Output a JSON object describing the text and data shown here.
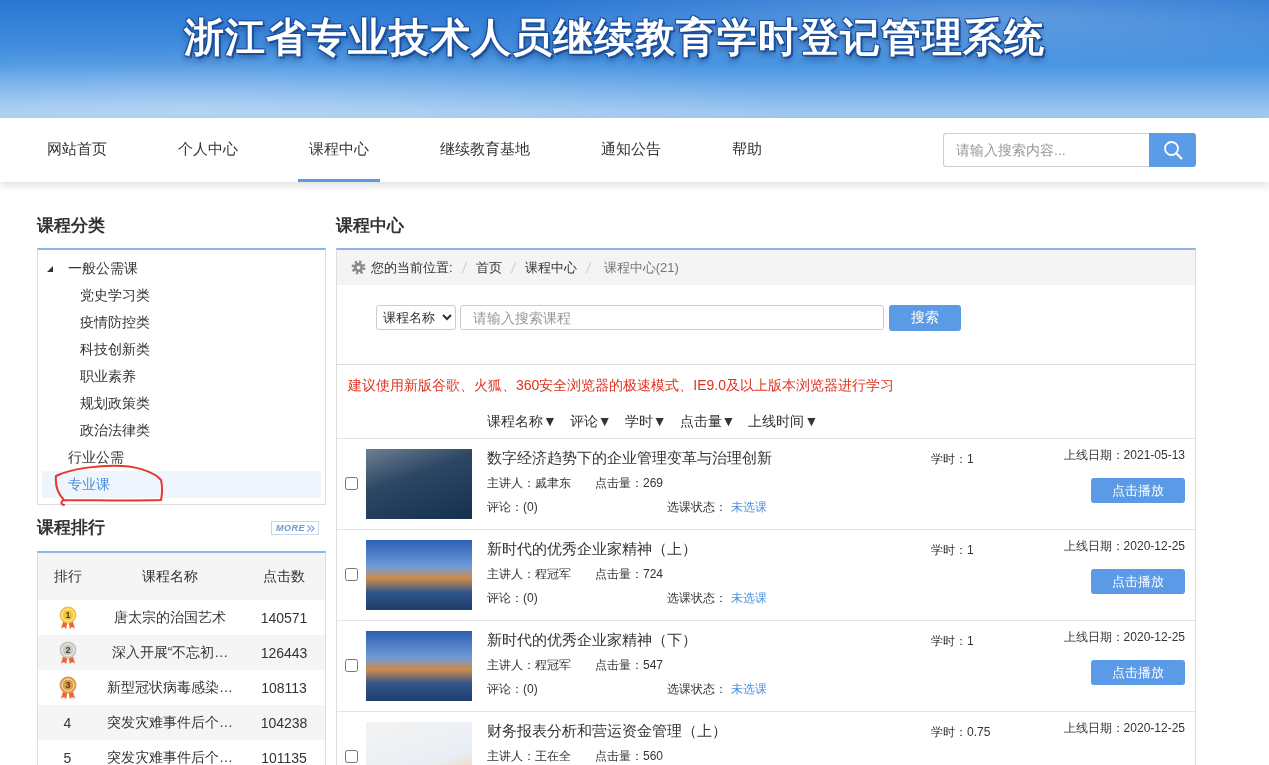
{
  "banner": {
    "title": "浙江省专业技术人员继续教育学时登记管理系统"
  },
  "nav": {
    "tabs": [
      {
        "label": "网站首页",
        "selected": false
      },
      {
        "label": "个人中心",
        "selected": false
      },
      {
        "label": "课程中心",
        "selected": true
      },
      {
        "label": "继续教育基地",
        "selected": false
      },
      {
        "label": "通知公告",
        "selected": false
      },
      {
        "label": "帮助",
        "selected": false
      }
    ],
    "search": {
      "placeholder": "请输入搜索内容..."
    }
  },
  "category_panel": {
    "title": "课程分类",
    "tree": [
      {
        "label": "一般公需课",
        "selected": false,
        "annotated": false,
        "expanded": true,
        "children": [
          {
            "label": "党史学习类",
            "selected": false,
            "annotated": false
          },
          {
            "label": "疫情防控类",
            "selected": false,
            "annotated": false
          },
          {
            "label": "科技创新类",
            "selected": false,
            "annotated": false
          },
          {
            "label": "职业素养",
            "selected": false,
            "annotated": false
          },
          {
            "label": "规划政策类",
            "selected": false,
            "annotated": false
          },
          {
            "label": "政治法律类",
            "selected": false,
            "annotated": false
          }
        ]
      },
      {
        "label": "行业公需",
        "selected": false,
        "annotated": false
      },
      {
        "label": "专业课",
        "selected": true,
        "annotated": true
      }
    ]
  },
  "ranking_panel": {
    "title": "课程排行",
    "more_link": "MORE",
    "columns": [
      "排行",
      "课程名称",
      "点击数"
    ],
    "rows": [
      {
        "kind": "medal",
        "rank": "1",
        "color": "#f4c63d",
        "name": "唐太宗的治国艺术",
        "clicks": "140571"
      },
      {
        "kind": "medal",
        "rank": "2",
        "color": "#c6c6c6",
        "name": "深入开展“不忘初…",
        "clicks": "126443"
      },
      {
        "kind": "medal",
        "rank": "3",
        "color": "#dc9a48",
        "name": "新型冠状病毒感染…",
        "clicks": "108113"
      },
      {
        "kind": "number",
        "rank": "4",
        "name": "突发灾难事件后个…",
        "clicks": "104238"
      },
      {
        "kind": "number",
        "rank": "5",
        "name": "突发灾难事件后个…",
        "clicks": "101135"
      }
    ]
  },
  "course_panel": {
    "title": "课程中心",
    "breadcrumb": {
      "label": "您的当前位置:",
      "items": [
        {
          "label": "首页",
          "current": false
        },
        {
          "label": "课程中心",
          "current": false
        },
        {
          "label": "课程中心(21)",
          "current": true
        }
      ]
    },
    "search": {
      "field_select": "课程名称",
      "placeholder": "请输入搜索课程",
      "button": "搜索"
    },
    "notice": "建议使用新版谷歌、火狐、360安全浏览器的极速模式、IE9.0及以上版本浏览器进行学习",
    "sort_links": [
      "课程名称▼",
      "评论▼",
      "学时▼",
      "点击量▼",
      "上线时间▼"
    ],
    "courses": [
      {
        "checked": false,
        "title": "数字经济趋势下的企业管理变革与治理创新",
        "lecturer": "主讲人：戚聿东",
        "clicks": "点击量：269",
        "comments": "评论：(0)",
        "status_label": "选课状态：",
        "status": "未选课",
        "hours": "学时：1",
        "date": "上线日期：2021-05-13",
        "button": "点击播放"
      },
      {
        "checked": false,
        "title": "新时代的优秀企业家精神（上）",
        "lecturer": "主讲人：程冠军",
        "clicks": "点击量：724",
        "comments": "评论：(0)",
        "status_label": "选课状态：",
        "status": "未选课",
        "hours": "学时：1",
        "date": "上线日期：2020-12-25",
        "button": "点击播放"
      },
      {
        "checked": false,
        "title": "新时代的优秀企业家精神（下）",
        "lecturer": "主讲人：程冠军",
        "clicks": "点击量：547",
        "comments": "评论：(0)",
        "status_label": "选课状态：",
        "status": "未选课",
        "hours": "学时：1",
        "date": "上线日期：2020-12-25",
        "button": "点击播放"
      },
      {
        "checked": false,
        "title": "财务报表分析和营运资金管理（上）",
        "lecturer": "主讲人：王在全",
        "clicks": "点击量：560",
        "hours": "学时：0.75",
        "date": "上线日期：2020-12-25"
      }
    ]
  }
}
